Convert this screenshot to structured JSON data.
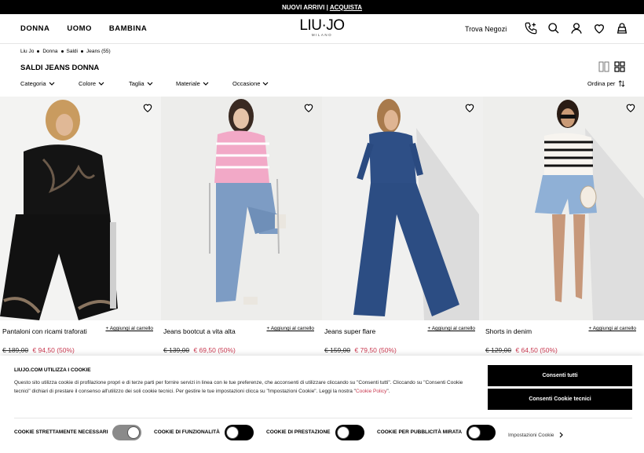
{
  "topbar": {
    "text": "NUOVI ARRIVI |",
    "link": "ACQUISTA"
  },
  "header": {
    "nav": [
      "DONNA",
      "UOMO",
      "BAMBINA"
    ],
    "logo": "LIU·JO",
    "logo_sub": "MILANO",
    "store_link": "Trova Negozi",
    "icons": [
      "phone-icon",
      "search-icon",
      "account-icon",
      "wishlist-icon",
      "bag-icon"
    ]
  },
  "breadcrumb": [
    "Liu Jo",
    "Donna",
    "Saldi",
    "Jeans (55)"
  ],
  "page_title": "SALDI JEANS DONNA",
  "filters": [
    "Categoria",
    "Colore",
    "Taglia",
    "Materiale",
    "Occasione"
  ],
  "sort_label": "Ordina per",
  "products": [
    {
      "name": "Pantaloni con ricami traforati",
      "add": "+ Aggiungi al carrello",
      "old_price": "€ 189,00",
      "new_price": "€ 94,50 (50%)"
    },
    {
      "name": "Jeans bootcut a vita alta",
      "add": "+ Aggiungi al carrello",
      "old_price": "€ 139,00",
      "new_price": "€ 69,50 (50%)"
    },
    {
      "name": "Jeans super flare",
      "add": "+ Aggiungi al carrello",
      "old_price": "€ 159,00",
      "new_price": "€ 79,50 (50%)"
    },
    {
      "name": "Shorts in denim",
      "add": "+ Aggiungi al carrello",
      "old_price": "€ 129,00",
      "new_price": "€ 64,50 (50%)"
    }
  ],
  "cookie": {
    "title": "LIUJO.COM UTILIZZA I COOKIE",
    "text": "Questo sito utilizza cookie di profilazione propri e di terze parti per fornire servizi in linea con le tue preferenze, che acconsenti di utilizzare cliccando su \"Consenti tutti\". Cliccando su \"Consenti Cookie tecnici\" dichiari di prestare il consenso all'utilizzo dei soli cookie tecnici. Per gestire le tue impostazioni clicca su \"Impostazioni Cookie\". Leggi la nostra \"",
    "policy_link": "Cookie Policy",
    "text_end": "\".",
    "accept_all": "Consenti tutti",
    "accept_technical": "Consenti Cookie tecnici",
    "toggles": [
      {
        "label": "COOKIE STRETTAMENTE NECESSARI",
        "state": "on-disabled"
      },
      {
        "label": "COOKIE DI FUNZIONALITÀ",
        "state": "off"
      },
      {
        "label": "COOKIE DI PRESTAZIONE",
        "state": "off"
      },
      {
        "label": "COOKIE PER PUBBLICITÀ MIRATA",
        "state": "off"
      }
    ],
    "settings_link": "Impostazioni Cookie"
  },
  "colors": {
    "sale_price": "#c8384f",
    "black": "#000000",
    "toggle_disabled": "#8a8a8a"
  }
}
